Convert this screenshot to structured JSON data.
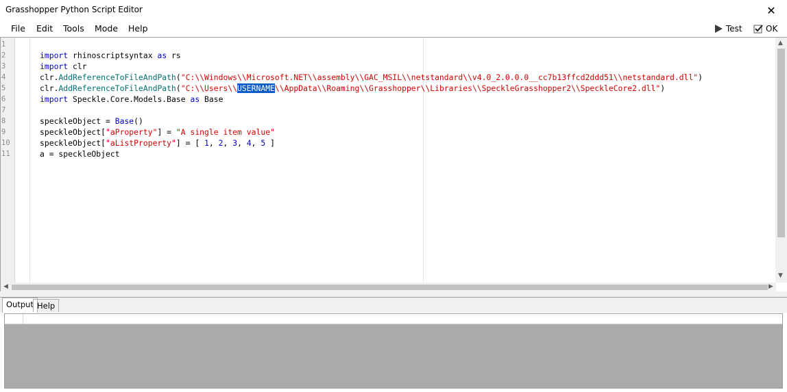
{
  "window": {
    "title": "Grasshopper Python Script Editor",
    "close_glyph": "✕"
  },
  "menu": [
    "File",
    "Edit",
    "Tools",
    "Mode",
    "Help"
  ],
  "toolbar": {
    "test_label": "Test",
    "ok_label": "OK"
  },
  "editor": {
    "line_numbers": [
      "1",
      "2",
      "3",
      "4",
      "5",
      "6",
      "7",
      "8",
      "9",
      "10",
      "11"
    ],
    "lines": [
      {
        "n": "1",
        "segments": []
      },
      {
        "n": "2",
        "segments": [
          [
            "kw",
            "import"
          ],
          [
            "",
            " rhinoscriptsyntax "
          ],
          [
            "kw2",
            "as"
          ],
          [
            "",
            " rs"
          ]
        ]
      },
      {
        "n": "3",
        "segments": [
          [
            "kw",
            "import"
          ],
          [
            "",
            " clr"
          ]
        ]
      },
      {
        "n": "4",
        "segments": [
          [
            "",
            "clr."
          ],
          [
            "fn",
            "AddReferenceToFileAndPath"
          ],
          [
            "",
            "("
          ],
          [
            "str",
            "\"C:\\\\Windows\\\\Microsoft.NET\\\\assembly\\\\GAC_MSIL\\\\netstandard\\\\v4.0_2.0.0.0__cc7b13ffcd2ddd51\\\\netstandard.dll\""
          ],
          [
            "",
            ")"
          ]
        ]
      },
      {
        "n": "5",
        "segments": [
          [
            "",
            "clr."
          ],
          [
            "fn",
            "AddReferenceToFileAndPath"
          ],
          [
            "",
            "("
          ],
          [
            "str",
            "\"C:\\\\Users\\\\"
          ],
          [
            "sel",
            "USERNAME"
          ],
          [
            "str",
            "\\\\AppData\\\\Roaming\\\\Grasshopper\\\\Libraries\\\\SpeckleGrasshopper2\\\\SpeckleCore2.dll\""
          ],
          [
            "",
            ")"
          ]
        ]
      },
      {
        "n": "6",
        "segments": [
          [
            "kw",
            "import"
          ],
          [
            "",
            " Speckle.Core.Models.Base "
          ],
          [
            "kw2",
            "as"
          ],
          [
            "",
            " Base"
          ]
        ]
      },
      {
        "n": "7",
        "segments": []
      },
      {
        "n": "8",
        "segments": [
          [
            "",
            "speckleObject = "
          ],
          [
            "kw",
            "Base"
          ],
          [
            "",
            "()"
          ]
        ]
      },
      {
        "n": "9",
        "segments": [
          [
            "",
            "speckleObject["
          ],
          [
            "str",
            "\"aProperty\""
          ],
          [
            "",
            "] = "
          ],
          [
            "str",
            "\"A single item value\""
          ]
        ]
      },
      {
        "n": "10",
        "segments": [
          [
            "",
            "speckleObject["
          ],
          [
            "str",
            "\"aListProperty\""
          ],
          [
            "",
            "] = [ "
          ],
          [
            "num",
            "1"
          ],
          [
            "",
            ", "
          ],
          [
            "num",
            "2"
          ],
          [
            "",
            ", "
          ],
          [
            "num",
            "3"
          ],
          [
            "",
            ", "
          ],
          [
            "num",
            "4"
          ],
          [
            "",
            ", "
          ],
          [
            "num",
            "5"
          ],
          [
            "",
            " ]"
          ]
        ]
      },
      {
        "n": "11",
        "segments": [
          [
            "",
            "a = speckleObject"
          ]
        ]
      }
    ]
  },
  "tabs": [
    "Output",
    "Help"
  ],
  "colors": {
    "keyword": "#0000c8",
    "string": "#d00000",
    "function": "#007070",
    "selection": "#0a5cc6"
  },
  "icons": {
    "test": "play-icon",
    "ok": "checkbox-icon"
  }
}
